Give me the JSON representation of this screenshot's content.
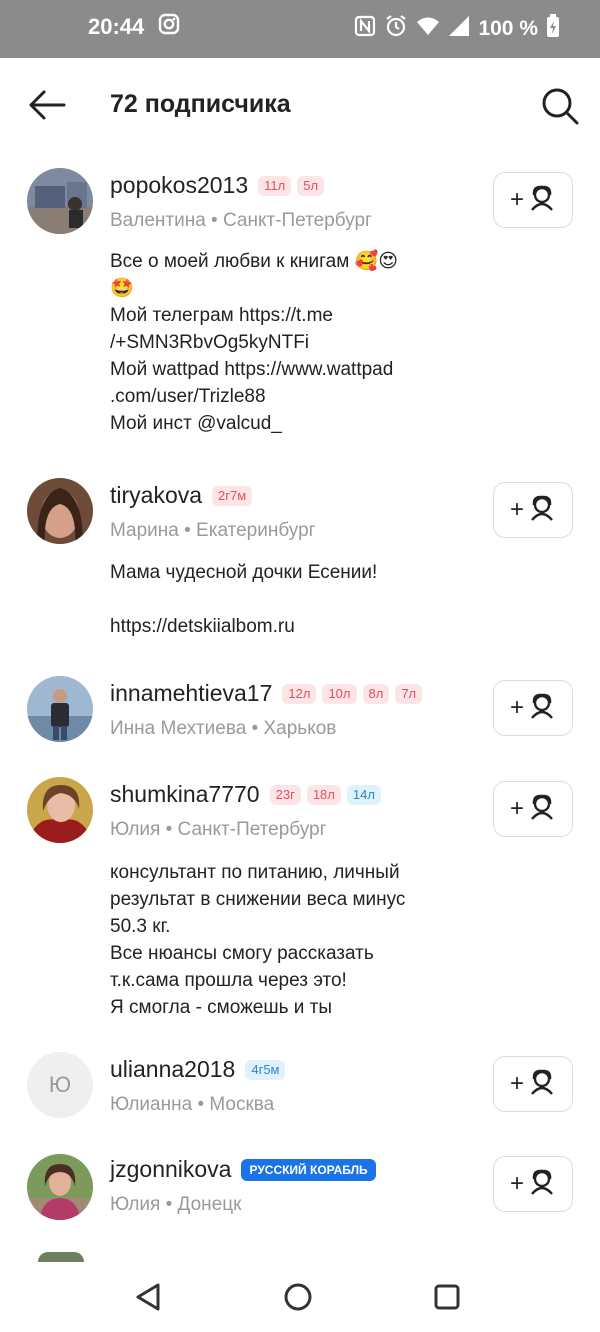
{
  "status": {
    "time": "20:44",
    "battery": "100 %",
    "icons": [
      "instagram-icon",
      "nfc-icon",
      "alarm-icon",
      "wifi-icon",
      "signal-icon",
      "battery-icon"
    ]
  },
  "header": {
    "title": "72 подписчика",
    "back_icon": "arrow-left-icon",
    "search_icon": "search-icon"
  },
  "follow_button_icon": "add-friend-icon",
  "users": [
    {
      "username": "popokos2013",
      "tags": [
        {
          "text": "11л",
          "kind": "pink"
        },
        {
          "text": "5л",
          "kind": "pink"
        }
      ],
      "subtitle": "Валентина • Санкт-Петербург",
      "bio": "Все о моей любви к книгам 🥰😍\n🤩\nМой телеграм https://t.me\n/+SMN3RbvOg5kyNTFi\nМой wattpad https://www.wattpad\n.com/user/Trizle88\nМой инст @valcud_",
      "avatar": "photo"
    },
    {
      "username": "tiryakova",
      "tags": [
        {
          "text": "2г7м",
          "kind": "pink"
        }
      ],
      "subtitle": "Марина • Екатеринбург",
      "bio": "Мама чудесной дочки Есении!\n\nhttps://detskiialbom.ru",
      "avatar": "photo"
    },
    {
      "username": "innamehtieva17",
      "tags": [
        {
          "text": "12л",
          "kind": "pink"
        },
        {
          "text": "10л",
          "kind": "pink"
        },
        {
          "text": "8л",
          "kind": "pink"
        },
        {
          "text": "7л",
          "kind": "pink"
        }
      ],
      "subtitle": "Инна Мехтиева • Харьков",
      "bio": "",
      "avatar": "photo"
    },
    {
      "username": "shumkina7770",
      "tags": [
        {
          "text": "23г",
          "kind": "pink"
        },
        {
          "text": "18л",
          "kind": "pink"
        },
        {
          "text": "14л",
          "kind": "blue"
        }
      ],
      "subtitle": "Юлия • Санкт-Петербург",
      "bio": "консультант по питанию, личный\nрезультат в снижении веса минус\n50.3 кг.\nВсе нюансы смогу рассказать\nт.к.сама прошла через это!\nЯ смогла - сможешь и ты",
      "avatar": "photo"
    },
    {
      "username": "ulianna2018",
      "tags": [
        {
          "text": "4г5м",
          "kind": "blue"
        }
      ],
      "subtitle": "Юлианна • Москва",
      "bio": "",
      "avatar": "Ю"
    },
    {
      "username": "jzgonnikova",
      "tags": [
        {
          "text": "РУССКИЙ КОРАБЛЬ",
          "kind": "ship"
        }
      ],
      "subtitle": "Юлия • Донецк",
      "bio": "",
      "avatar": "photo"
    }
  ],
  "nav": {
    "back_icon": "triangle-back-icon",
    "home_icon": "circle-home-icon",
    "recents_icon": "square-recents-icon"
  }
}
